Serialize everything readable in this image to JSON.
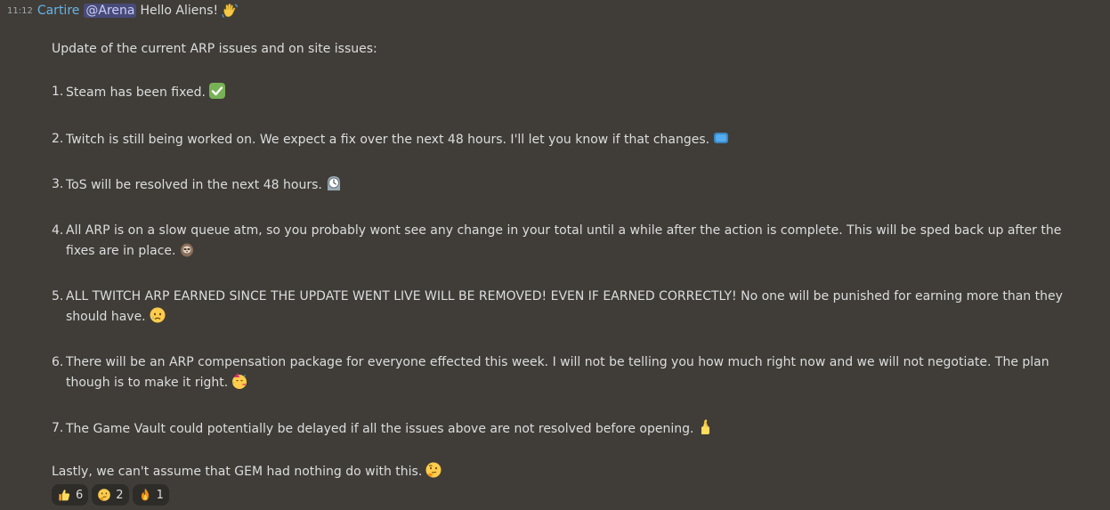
{
  "message": {
    "timestamp": "11:12",
    "username": "Cartire",
    "mention": "@Arena",
    "greeting": "Hello Aliens!",
    "intro": "Update of the current ARP issues and on site issues:",
    "items": [
      {
        "num": "1.",
        "text": "Steam has been fixed.",
        "emoji": "check-mark-icon"
      },
      {
        "num": "2.",
        "text": "Twitch is still being worked on. We expect a fix over the next 48 hours. I'll let you know if that changes.",
        "emoji": "tv-icon"
      },
      {
        "num": "3.",
        "text": "ToS will be resolved in the next 48 hours.",
        "emoji": "mantelpiece-clock-icon"
      },
      {
        "num": "4.",
        "text": "All ARP is on a slow queue atm, so you probably wont see any change in your total until a while after the action is complete. This will be sped back up after the fixes are in place.",
        "emoji": "sloth-icon"
      },
      {
        "num": "5.",
        "text": "ALL TWITCH ARP EARNED SINCE THE UPDATE WENT LIVE WILL BE REMOVED! EVEN IF EARNED CORRECTLY!  No one will be punished for earning more than they should have.",
        "emoji": "sad-tear-face-icon"
      },
      {
        "num": "6.",
        "text": "There will be an ARP compensation package for everyone effected this week. I will not be telling you how much right now and we will not negotiate. The plan though is to make it right.",
        "emoji": "partying-face-icon"
      },
      {
        "num": "7.",
        "text": "The Game Vault could potentially be delayed if all the issues above are not resolved before opening.",
        "emoji": "crossed-fingers-icon"
      }
    ],
    "closing": "Lastly, we can't assume that GEM had nothing do with this."
  },
  "reactions": [
    {
      "emoji": "thumbs-up-icon",
      "count": "6"
    },
    {
      "emoji": "thinking-face-icon",
      "count": "2"
    },
    {
      "emoji": "fire-icon",
      "count": "1"
    }
  ],
  "colors": {
    "background": "#403d38",
    "username": "#66b3e8",
    "mention_bg": "#5865f2",
    "text": "#dcddde"
  }
}
